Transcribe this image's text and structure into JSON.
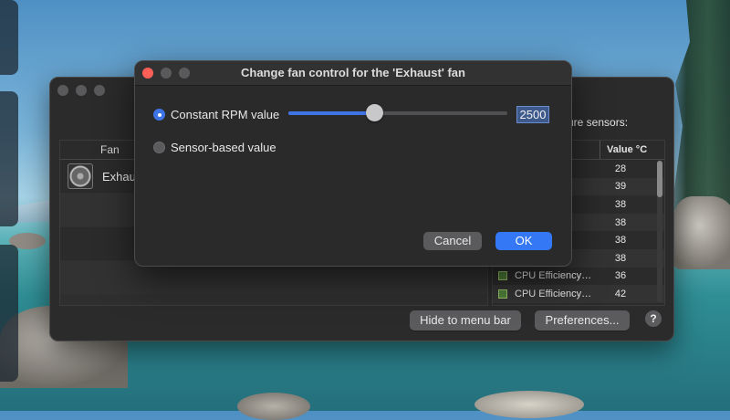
{
  "main_window": {
    "fan_column": "Fan",
    "fan_name": "Exhaus",
    "sensors_label": "ure sensors:",
    "value_column": "Value °C",
    "sensors": [
      {
        "name": "ximi…",
        "value": "28"
      },
      {
        "name": "ver…",
        "value": "39"
      },
      {
        "name": "iency…",
        "value": "38"
      },
      {
        "name": "iency…",
        "value": "38"
      },
      {
        "name": "iency…",
        "value": "38"
      },
      {
        "name": "iency…",
        "value": "38"
      },
      {
        "name": "CPU Efficiency…",
        "value": "36"
      },
      {
        "name": "CPU Efficiency…",
        "value": "42"
      }
    ],
    "hide_button": "Hide to menu bar",
    "preferences_button": "Preferences...",
    "help_button": "?"
  },
  "dialog": {
    "title": "Change fan control for the 'Exhaust' fan",
    "constant_label": "Constant RPM value",
    "sensor_label": "Sensor-based value",
    "rpm_value": "2500",
    "slider_fraction": 0.39,
    "cancel_button": "Cancel",
    "ok_button": "OK"
  },
  "colors": {
    "accent": "#3f74e6",
    "window_bg": "#2b2b2c"
  }
}
